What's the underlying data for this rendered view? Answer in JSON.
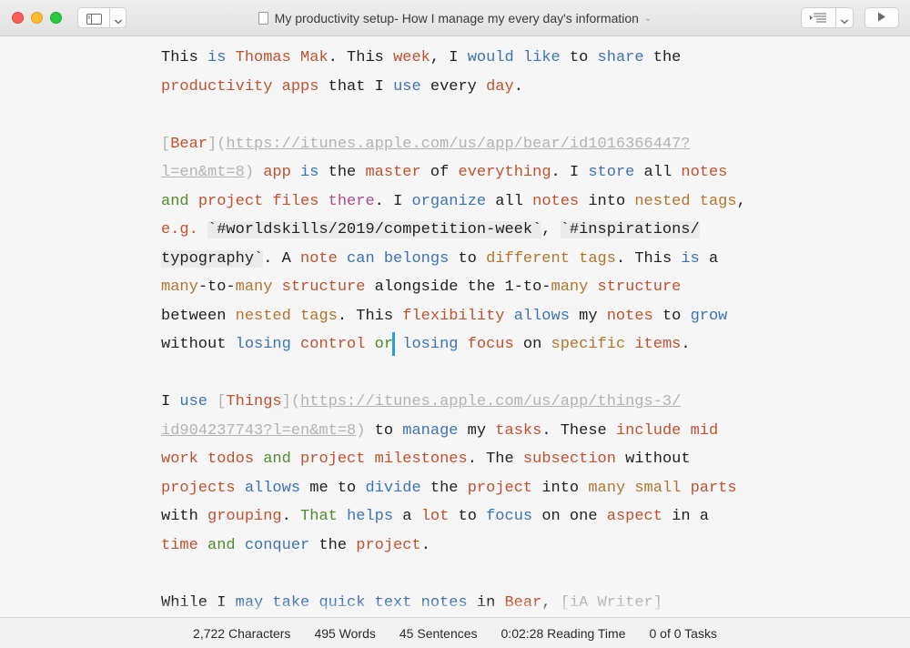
{
  "window": {
    "title": "My productivity setup- How I manage my every day's information",
    "title_chevron": "⌄"
  },
  "toolbar": {
    "sidebar_icon": "sidebar-icon",
    "chevron_icon": "chevron-down-icon",
    "outline_icon": "outline-icon",
    "play_icon": "play-icon"
  },
  "paragraphs": {
    "p1": {
      "l1": [
        "This ",
        "is",
        " ",
        "Thomas",
        " ",
        "Mak",
        ". This ",
        "week",
        ", I ",
        "would",
        " ",
        "like",
        " to ",
        "share",
        " the"
      ],
      "l2": [
        "productivity",
        " ",
        "apps",
        " that I ",
        "use",
        " every ",
        "day",
        "."
      ]
    },
    "p2": {
      "l1": [
        "[",
        "Bear",
        "](",
        "https://itunes.apple.com/us/app/bear/id1016366447?"
      ],
      "l2": [
        "l=en&mt=8",
        ") ",
        "app",
        " ",
        "is",
        " the ",
        "master",
        " of ",
        "everything",
        ". I ",
        "store",
        " all ",
        "notes"
      ],
      "l3": [
        "and",
        " ",
        "project",
        " ",
        "files",
        " ",
        "there",
        ". I ",
        "organize",
        " all ",
        "notes",
        " into ",
        "nested",
        " ",
        "tags",
        ","
      ],
      "l4": [
        "e.g.",
        " ",
        "`#worldskills/2019/competition-week`",
        ", ",
        "`#inspirations/"
      ],
      "l5": [
        "typography`",
        ". A ",
        "note",
        " ",
        "can",
        " ",
        "belongs",
        " to ",
        "different",
        " ",
        "tags",
        ". This ",
        "is",
        " a"
      ],
      "l6": [
        "many",
        "-to-",
        "many",
        " ",
        "structure",
        " alongside the 1-to-",
        "many",
        " ",
        "structure"
      ],
      "l7": [
        "between ",
        "nested",
        " ",
        "tags",
        ". This ",
        "flexibility",
        " ",
        "allows",
        " my ",
        "notes",
        " to ",
        "grow"
      ],
      "l8a": [
        "without ",
        "losing",
        " ",
        "control",
        " ",
        "or"
      ],
      "l8b": [
        " ",
        "losing",
        " ",
        "focus",
        " on ",
        "specific",
        " ",
        "items",
        "."
      ]
    },
    "p3": {
      "l1": [
        "I ",
        "use",
        " ",
        "[",
        "Things",
        "](",
        "https://itunes.apple.com/us/app/things-3/"
      ],
      "l2": [
        "id904237743?l=en&mt=8",
        ")",
        " to ",
        "manage",
        " my ",
        "tasks",
        ". These ",
        "include",
        " ",
        "mid"
      ],
      "l3": [
        "work",
        " ",
        "todos",
        " ",
        "and",
        " ",
        "project",
        " ",
        "milestones",
        ". The ",
        "subsection",
        " without"
      ],
      "l4": [
        "projects",
        " ",
        "allows",
        " me to ",
        "divide",
        " the ",
        "project",
        " into ",
        "many",
        " ",
        "small",
        " ",
        "parts"
      ],
      "l5": [
        "with ",
        "grouping",
        ". ",
        "That",
        " ",
        "helps",
        " a ",
        "lot",
        " to ",
        "focus",
        " on one ",
        "aspect",
        " in a"
      ],
      "l6": [
        "time",
        " ",
        "and",
        " ",
        "conquer",
        " the ",
        "project",
        "."
      ]
    },
    "p4": {
      "l1": [
        "While I ",
        "may take quick text notes",
        " in ",
        "Bear",
        ", ",
        "[iA Writer]"
      ]
    }
  },
  "status": {
    "characters": "2,722 Characters",
    "words": "495 Words",
    "sentences": "45 Sentences",
    "reading_time": "0:02:28 Reading Time",
    "tasks": "0 of 0 Tasks"
  },
  "colors": {
    "keyword_red": "#c0512f",
    "keyword_blue": "#3d72b6",
    "keyword_green": "#4f8a2e",
    "keyword_orange": "#b0742c",
    "cursor": "#2a9fd6",
    "link_markup": "#b3b3b3"
  }
}
